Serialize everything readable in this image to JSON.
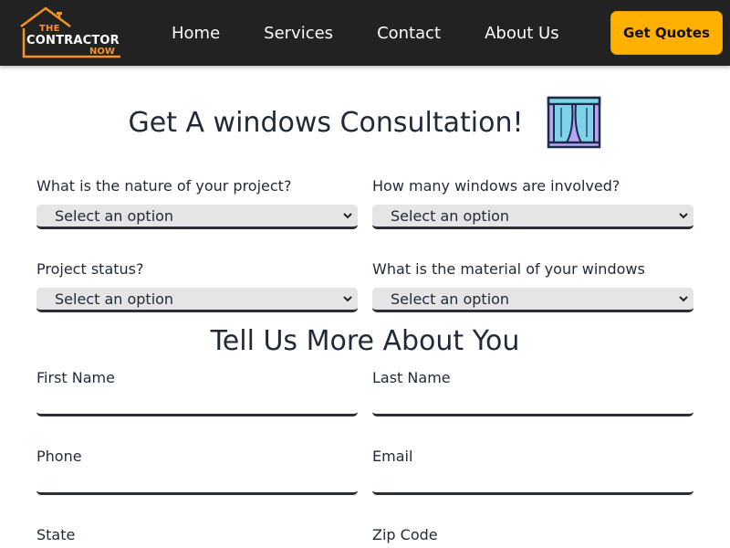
{
  "nav": {
    "logo": {
      "line1": "THE",
      "line2": "CONTRACTOR",
      "line3": "NOW"
    },
    "links": [
      "Home",
      "Services",
      "Contact",
      "About Us"
    ],
    "cta_label": "Get Quotes"
  },
  "page": {
    "title": "Get A windows Consultation!",
    "title_icon": "window-curtains-icon"
  },
  "project_form": {
    "fields": [
      {
        "label": "What is the nature of your project?",
        "value": "Select an option"
      },
      {
        "label": "How many windows are involved?",
        "value": "Select an option"
      },
      {
        "label": "Project status?",
        "value": "Select an option"
      },
      {
        "label": "What is the material of your windows",
        "value": "Select an option"
      }
    ]
  },
  "about_you": {
    "title": "Tell Us More About You",
    "fields": [
      {
        "label": "First Name",
        "value": ""
      },
      {
        "label": "Last Name",
        "value": ""
      },
      {
        "label": "Phone",
        "value": ""
      },
      {
        "label": "Email",
        "value": ""
      },
      {
        "label": "State",
        "value": ""
      },
      {
        "label": "Zip Code",
        "value": ""
      }
    ]
  },
  "colors": {
    "navbar_bg": "#222222",
    "accent": "#ffb000",
    "logo_orange": "#f7941d",
    "text": "#1f2937",
    "select_bg": "#e5e5e5"
  }
}
